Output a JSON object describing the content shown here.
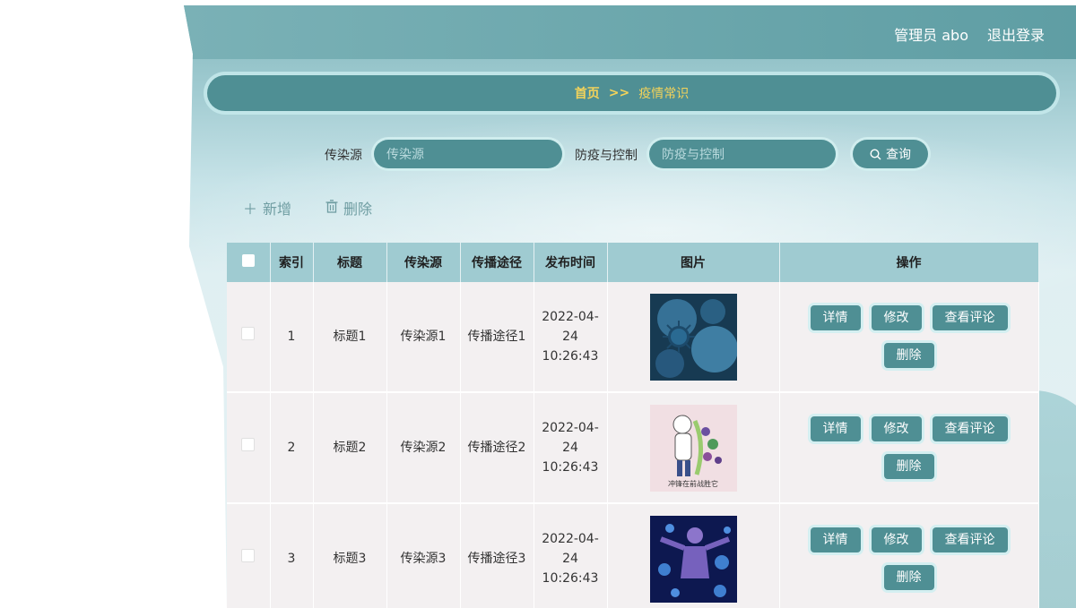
{
  "header": {
    "user": "管理员 abo",
    "logout": "退出登录"
  },
  "breadcrumb": {
    "home": "首页",
    "separator": ">>",
    "current": "疫情常识"
  },
  "search": {
    "field1_label": "传染源",
    "field1_placeholder": "传染源",
    "field2_label": "防疫与控制",
    "field2_placeholder": "防疫与控制",
    "button_label": "查询"
  },
  "actions": {
    "add": "新增",
    "delete": "删除"
  },
  "table": {
    "headers": [
      "索引",
      "标题",
      "传染源",
      "传播途径",
      "发布时间",
      "图片",
      "操作"
    ],
    "rows": [
      {
        "index": "1",
        "title": "标题1",
        "source": "传染源1",
        "route": "传播途径1",
        "time": "2022-04-24 10:26:43",
        "image": "virus-cells-image"
      },
      {
        "index": "2",
        "title": "标题2",
        "source": "传染源2",
        "route": "传播途径2",
        "time": "2022-04-24 10:26:43",
        "image": "doctor-cartoon-image",
        "image_caption": "冲锋在前战胜它"
      },
      {
        "index": "3",
        "title": "标题3",
        "source": "传染源3",
        "route": "传播途径3",
        "time": "2022-04-24 10:26:43",
        "image": "human-figure-virus-image"
      }
    ],
    "row_actions": {
      "detail": "详情",
      "edit": "修改",
      "comments": "查看评论",
      "delete": "删除"
    }
  },
  "colors": {
    "accent": "#4f8f94",
    "highlight": "#f3d35a",
    "header_bg": "#9fcbd1"
  }
}
